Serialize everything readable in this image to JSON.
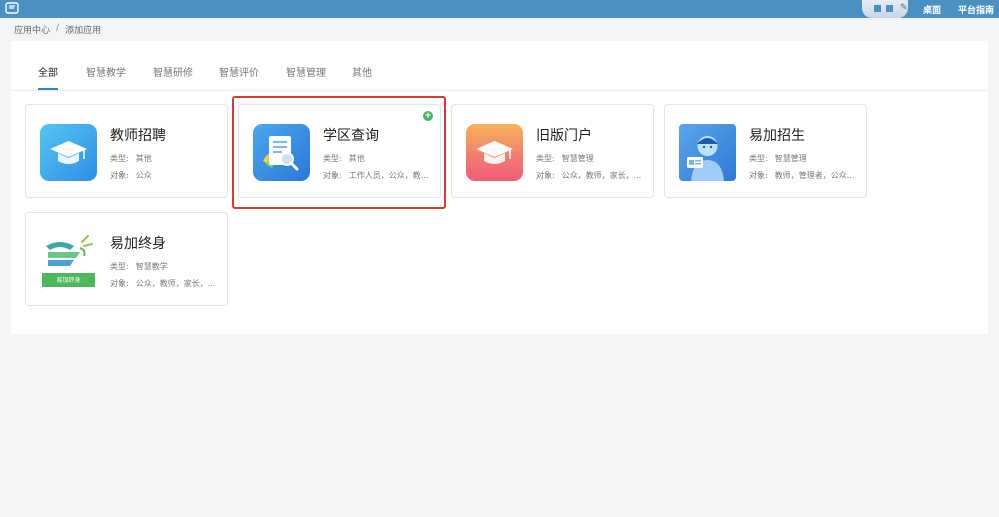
{
  "topbar": {
    "logo_icon": "app-logo-icon",
    "links": {
      "desktop": "桌面",
      "guide": "平台指南"
    },
    "accent": "#4a90c2"
  },
  "breadcrumb": {
    "root": "应用中心",
    "sep": "/",
    "current": "添加应用"
  },
  "tabs": [
    {
      "label": "全部",
      "active": true
    },
    {
      "label": "智慧教学"
    },
    {
      "label": "智慧研修"
    },
    {
      "label": "智慧评价"
    },
    {
      "label": "智慧管理"
    },
    {
      "label": "其他"
    }
  ],
  "apps": [
    {
      "name": "教师招聘",
      "type_label": "类型:",
      "type": "其他",
      "target_label": "对象:",
      "target": "公众",
      "icon": "graduation-cap-icon"
    },
    {
      "name": "学区查询",
      "type_label": "类型:",
      "type": "其他",
      "target_label": "对象:",
      "target": "工作人员，公众，教...",
      "icon": "document-search-icon",
      "highlighted": true,
      "add_badge": "+"
    },
    {
      "name": "旧版门户",
      "type_label": "类型:",
      "type": "智慧管理",
      "target_label": "对象:",
      "target": "公众，教师，家长，...",
      "icon": "graduation-cap-icon"
    },
    {
      "name": "易加招生",
      "type_label": "类型:",
      "type": "智慧管理",
      "target_label": "对象:",
      "target": "教师，管理者，公众...",
      "icon": "student-id-icon"
    },
    {
      "name": "易加终身",
      "type_label": "类型:",
      "type": "智慧教学",
      "target_label": "对象:",
      "target": "公众，教师，家长，...",
      "icon": "yijia-logo-icon",
      "icon_caption": "易加终身"
    }
  ]
}
